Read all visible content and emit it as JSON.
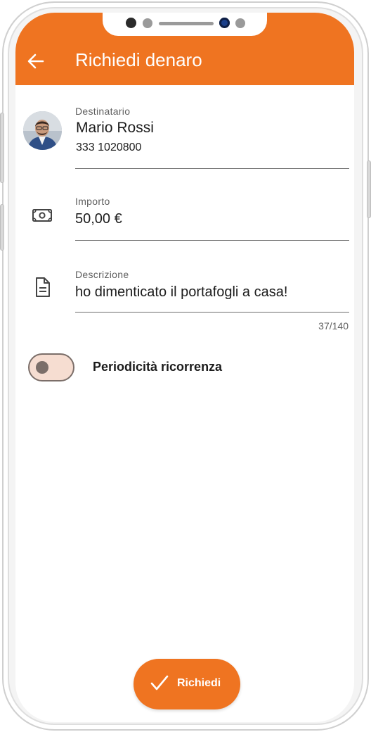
{
  "appbar": {
    "title": "Richiedi denaro",
    "back_icon": "arrow-left-icon",
    "color": "#ef7421"
  },
  "recipient": {
    "label": "Destinatario",
    "name": "Mario Rossi",
    "phone": "333 1020800",
    "avatar_icon": "avatar"
  },
  "amount": {
    "label": "Importo",
    "value": "50,00 €",
    "icon": "banknote-icon"
  },
  "description": {
    "label": "Descrizione",
    "value": "ho dimenticato il portafogli a casa!",
    "counter": "37/140",
    "icon": "document-icon"
  },
  "recurrence": {
    "label": "Periodicità ricorrenza",
    "enabled": false
  },
  "submit": {
    "label": "Richiedi",
    "icon": "check-icon"
  }
}
